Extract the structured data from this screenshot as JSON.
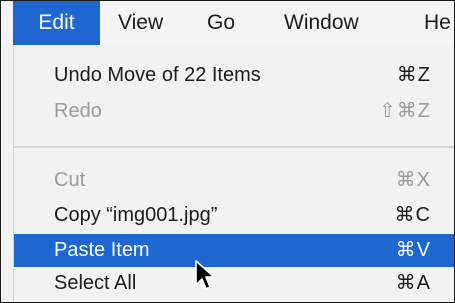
{
  "menubar": {
    "items": [
      {
        "label": "Edit",
        "active": true
      },
      {
        "label": "View"
      },
      {
        "label": "Go"
      },
      {
        "label": "Window"
      },
      {
        "label": "He"
      }
    ]
  },
  "edit_menu": {
    "items": [
      {
        "label": "Undo Move of 22 Items",
        "shortcut": "⌘Z",
        "state": "enabled"
      },
      {
        "label": "Redo",
        "shortcut": "⇧⌘Z",
        "state": "disabled"
      },
      {
        "label": "Cut",
        "shortcut": "⌘X",
        "state": "disabled"
      },
      {
        "label": "Copy “img001.jpg”",
        "shortcut": "⌘C",
        "state": "enabled"
      },
      {
        "label": "Paste Item",
        "shortcut": "⌘V",
        "state": "highlighted"
      },
      {
        "label": "Select All",
        "shortcut": "⌘A",
        "state": "enabled"
      }
    ]
  },
  "colors": {
    "highlight": "#1e66d0",
    "menu_background": "#f2f2f2",
    "disabled_text": "#9a9a9a"
  },
  "icons": {
    "cursor": "arrow-cursor-icon"
  }
}
